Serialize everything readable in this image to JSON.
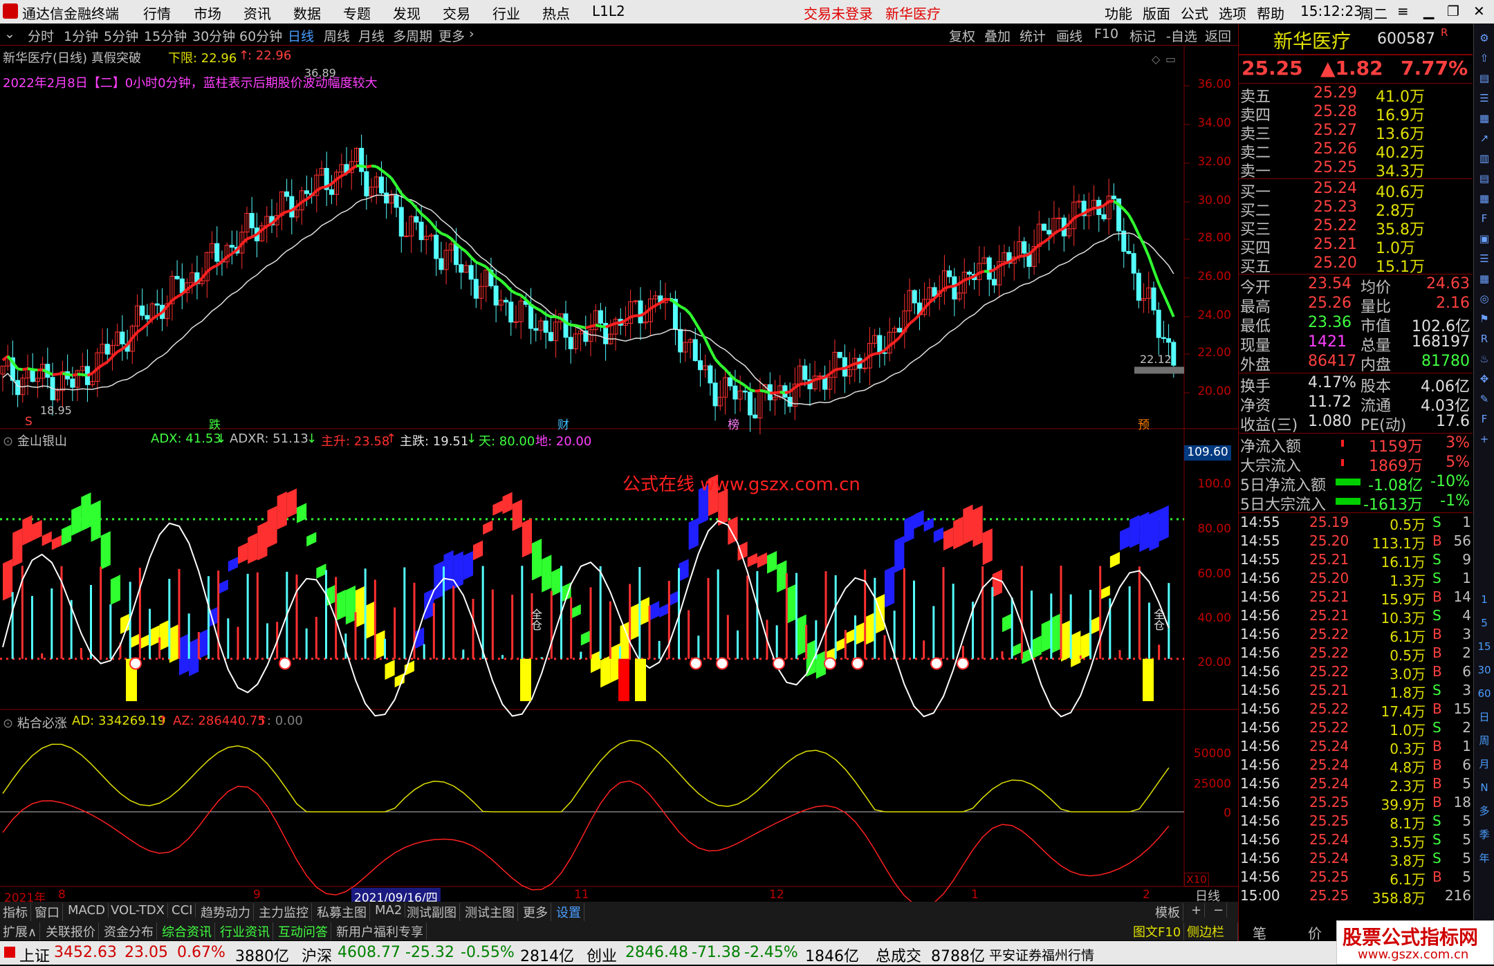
{
  "menubar": {
    "app_title": "通达信金融终端",
    "items": [
      "行情",
      "市场",
      "资讯",
      "数据",
      "专题",
      "发现",
      "交易",
      "行业",
      "热点",
      "L1L2"
    ],
    "login": "交易未登录",
    "stock_name": "新华医疗",
    "right_items": [
      "功能",
      "版面",
      "公式",
      "选项",
      "帮助"
    ],
    "time": "15:12:23",
    "weekday": "周二"
  },
  "periodbar": {
    "periods": [
      "分时",
      "1分钟",
      "5分钟",
      "15分钟",
      "30分钟",
      "60分钟",
      "日线",
      "周线",
      "月线",
      "多周期",
      "更多"
    ],
    "active_period": "日线",
    "tools": [
      "复权",
      "叠加",
      "统计",
      "画线",
      "F10",
      "标记",
      "-自选",
      "返回"
    ]
  },
  "main_chart": {
    "title": "新华医疗(日线)",
    "indicator": "真假突破",
    "lower_label": "下限: 22.96",
    "lower_value2": ": 22.96",
    "note": "2022年2月8日【二】0小时0分钟，蓝柱表示后期股价波动幅度较大",
    "high_mark": "36.89",
    "low_mark": "18.95",
    "last_mark": "22.12",
    "y_ticks": [
      "36.00",
      "34.00",
      "32.00",
      "30.00",
      "28.00",
      "26.00",
      "24.00",
      "22.00",
      "20.00"
    ],
    "markers": [
      "S",
      "跌",
      "财",
      "榜",
      "预"
    ]
  },
  "indicator1": {
    "title": "金山银山",
    "adx": "ADX: 41.53",
    "adxr": "ADXR: 51.13",
    "zhusheng": "主升: 23.58",
    "zhudie": "主跌: 19.51",
    "tian": "天: 80.00",
    "di": "地: 20.00",
    "top_value": "109.60",
    "y_ticks": [
      "100.0",
      "80.00",
      "60.00",
      "40.00",
      "20.00"
    ],
    "watermark": "公式在线 www.gszx.com.cn",
    "quan_label": "全仓"
  },
  "indicator2": {
    "title": "粘合必涨",
    "ad": "AD: 334269.19",
    "az": "AZ: 286440.75",
    "zero": ": 0.00",
    "y_ticks": [
      "50000",
      "25000",
      "0"
    ],
    "x10": "X10"
  },
  "date_axis": {
    "labels": [
      "2021年",
      "8",
      "9",
      "2021/09/16/四",
      "11",
      "12",
      "1",
      "2"
    ],
    "period": "日线"
  },
  "bottom_tabs": {
    "row1": [
      "指标",
      "窗口",
      "MACD",
      "VOL-TDX",
      "CCI",
      "趋势动力",
      "主力监控",
      "私募主图",
      "MA2",
      "测试副图",
      "测试主图",
      "更多",
      "设置"
    ],
    "row1_right": [
      "模板",
      "+",
      "−"
    ],
    "row2": [
      "扩展∧",
      "关联报价",
      "资金分布",
      "综合资讯",
      "行业资讯",
      "互动问答",
      "新用户福利专享"
    ],
    "row2_right": [
      "图文F10",
      "侧边栏《"
    ]
  },
  "quote": {
    "name": "新华医疗",
    "code": "600587",
    "r_badge": "R",
    "price": "25.25",
    "change": "▲1.82",
    "change_pct": "7.77%",
    "sells": [
      {
        "label": "卖五",
        "price": "25.29",
        "vol": "41.0万"
      },
      {
        "label": "卖四",
        "price": "25.28",
        "vol": "16.9万"
      },
      {
        "label": "卖三",
        "price": "25.27",
        "vol": "13.6万"
      },
      {
        "label": "卖二",
        "price": "25.26",
        "vol": "40.2万"
      },
      {
        "label": "卖一",
        "price": "25.25",
        "vol": "34.3万"
      }
    ],
    "buys": [
      {
        "label": "买一",
        "price": "25.24",
        "vol": "40.6万"
      },
      {
        "label": "买二",
        "price": "25.23",
        "vol": "2.8万"
      },
      {
        "label": "买三",
        "price": "25.22",
        "vol": "35.8万"
      },
      {
        "label": "买四",
        "price": "25.21",
        "vol": "1.0万"
      },
      {
        "label": "买五",
        "price": "25.20",
        "vol": "15.1万"
      }
    ],
    "stats": [
      {
        "l1": "今开",
        "v1": "23.54",
        "l2": "均价",
        "v2": "24.63"
      },
      {
        "l1": "最高",
        "v1": "25.26",
        "l2": "量比",
        "v2": "2.16"
      },
      {
        "l1": "最低",
        "v1": "23.36",
        "l2": "市值",
        "v2": "102.6亿"
      },
      {
        "l1": "现量",
        "v1": "1421",
        "l2": "总量",
        "v2": "168197"
      },
      {
        "l1": "外盘",
        "v1": "86417",
        "l2": "内盘",
        "v2": "81780"
      }
    ],
    "fund": [
      {
        "l1": "换手",
        "v1": "4.17%",
        "l2": "股本",
        "v2": "4.06亿"
      },
      {
        "l1": "净资",
        "v1": "11.72",
        "l2": "流通",
        "v2": "4.03亿"
      },
      {
        "l1": "收益(三)",
        "v1": "1.080",
        "l2": "PE(动)",
        "v2": "17.6"
      }
    ],
    "flows": [
      {
        "label": "净流入额",
        "value": "1159万",
        "pct": "3%"
      },
      {
        "label": "大宗流入",
        "value": "1869万",
        "pct": "5%"
      },
      {
        "label": "5日净流入额",
        "value": "-1.08亿",
        "pct": "-10%"
      },
      {
        "label": "5日大宗流入",
        "value": "-1613万",
        "pct": "-1%"
      }
    ],
    "ticks": [
      {
        "t": "14:55",
        "p": "25.19",
        "v": "0.5万",
        "d": "S",
        "n": "1"
      },
      {
        "t": "14:55",
        "p": "25.20",
        "v": "113.1万",
        "d": "B",
        "n": "56"
      },
      {
        "t": "14:55",
        "p": "25.21",
        "v": "16.1万",
        "d": "S",
        "n": "9"
      },
      {
        "t": "14:56",
        "p": "25.20",
        "v": "1.3万",
        "d": "S",
        "n": "1"
      },
      {
        "t": "14:56",
        "p": "25.21",
        "v": "15.9万",
        "d": "B",
        "n": "14"
      },
      {
        "t": "14:56",
        "p": "25.21",
        "v": "10.3万",
        "d": "S",
        "n": "4"
      },
      {
        "t": "14:56",
        "p": "25.22",
        "v": "6.1万",
        "d": "B",
        "n": "3"
      },
      {
        "t": "14:56",
        "p": "25.22",
        "v": "0.5万",
        "d": "B",
        "n": "2"
      },
      {
        "t": "14:56",
        "p": "25.22",
        "v": "3.0万",
        "d": "B",
        "n": "6"
      },
      {
        "t": "14:56",
        "p": "25.21",
        "v": "1.8万",
        "d": "S",
        "n": "3"
      },
      {
        "t": "14:56",
        "p": "25.22",
        "v": "17.4万",
        "d": "B",
        "n": "15"
      },
      {
        "t": "14:56",
        "p": "25.22",
        "v": "1.0万",
        "d": "S",
        "n": "2"
      },
      {
        "t": "14:56",
        "p": "25.24",
        "v": "0.3万",
        "d": "B",
        "n": "1"
      },
      {
        "t": "14:56",
        "p": "25.24",
        "v": "4.8万",
        "d": "B",
        "n": "6"
      },
      {
        "t": "14:56",
        "p": "25.24",
        "v": "2.3万",
        "d": "B",
        "n": "5"
      },
      {
        "t": "14:56",
        "p": "25.25",
        "v": "39.9万",
        "d": "B",
        "n": "18"
      },
      {
        "t": "14:56",
        "p": "25.25",
        "v": "8.1万",
        "d": "S",
        "n": "5"
      },
      {
        "t": "14:56",
        "p": "25.24",
        "v": "3.5万",
        "d": "S",
        "n": "5"
      },
      {
        "t": "14:56",
        "p": "25.24",
        "v": "3.8万",
        "d": "S",
        "n": "5"
      },
      {
        "t": "14:56",
        "p": "25.25",
        "v": "6.1万",
        "d": "B",
        "n": "5"
      },
      {
        "t": "15:00",
        "p": "25.25",
        "v": "358.8万",
        "d": "",
        "n": "216"
      }
    ],
    "bottom_tabs": [
      "笔",
      "价",
      "细",
      "势"
    ]
  },
  "statusbar": {
    "sh_label": "上证",
    "sh_val": "3452.63",
    "sh_chg": "23.05",
    "sh_pct": "0.67%",
    "sh_amt": "3880亿",
    "hs_label": "沪深",
    "hs_val": "4608.77",
    "hs_chg": "-25.32",
    "hs_pct": "-0.55%",
    "hs_amt": "2814亿",
    "cy_label": "创业",
    "cy_val": "2846.48",
    "cy_chg": "-71.38",
    "cy_pct": "-2.45%",
    "cy_amt": "1846亿",
    "total_label": "总成交",
    "total_val": "8788亿",
    "source": "平安证券福州行情",
    "watermark_top": "股票公式指标网",
    "watermark_bottom": "www.gszx.com.cn"
  },
  "sidebar": {
    "icons": [
      "gear-icon",
      "up-icon",
      "chart-icon",
      "list-icon",
      "bar-icon",
      "line-icon",
      "grid-icon",
      "info-icon",
      "doc-icon",
      "fin-icon",
      "cal-icon",
      "news-icon",
      "fs-icon",
      "circle-icon",
      "flag-icon",
      "rsi-icon",
      "flame-icon",
      "move-icon",
      "pen-icon",
      "fs-icon2",
      "plus-icon"
    ],
    "periods": [
      "1",
      "5",
      "15",
      "30",
      "60",
      "日",
      "周",
      "月",
      "N",
      "多",
      "季",
      "年"
    ]
  }
}
